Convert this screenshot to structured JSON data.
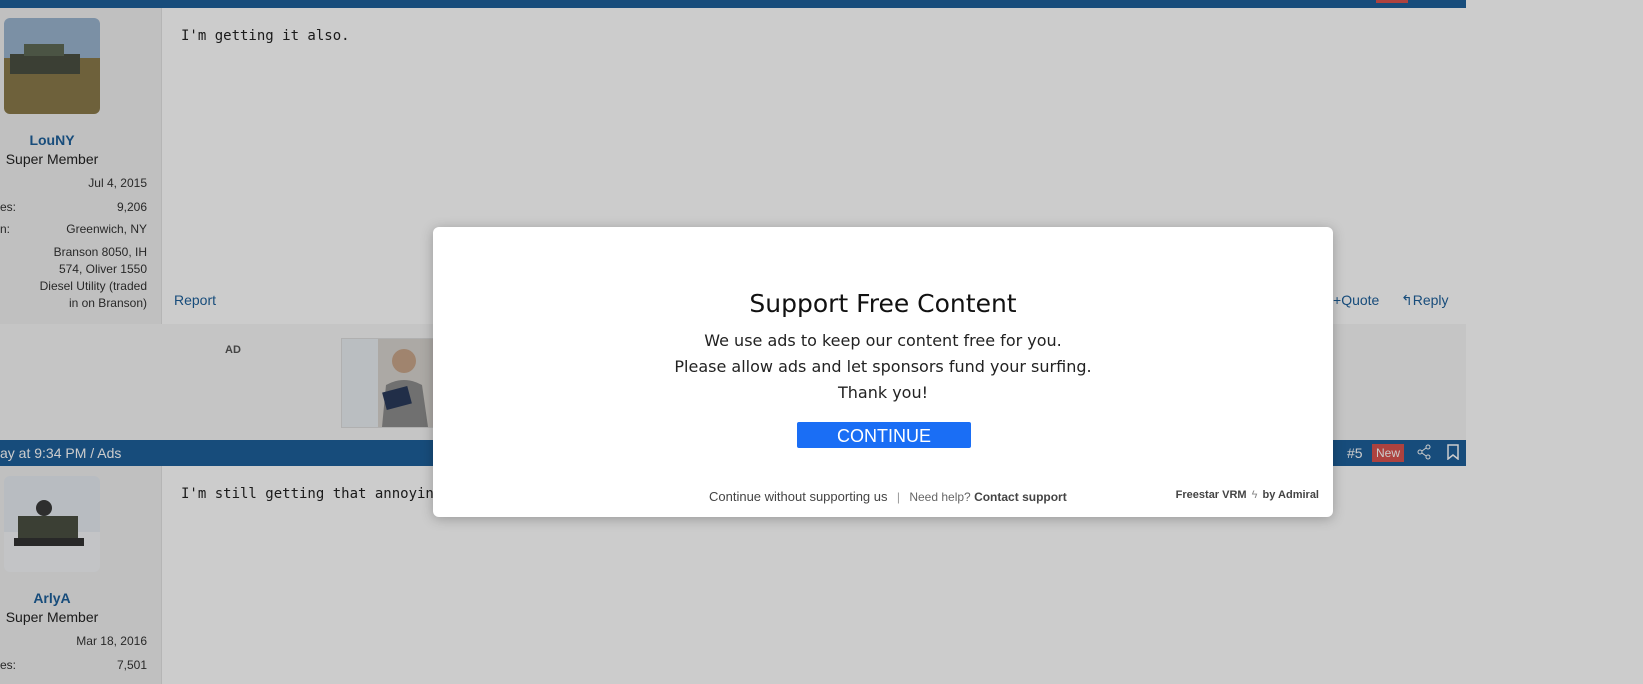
{
  "post1": {
    "username": "LouNY",
    "user_title": "Super Member",
    "joined": "Jul 4, 2015",
    "messages_key": "es:",
    "messages": "9,206",
    "location_key": "n:",
    "location": "Greenwich, NY",
    "equipment_lines": [
      "Branson 8050, IH",
      "574, Oliver 1550",
      "Diesel Utility (traded",
      "in on Branson)"
    ],
    "content": "I'm getting it also.",
    "report_label": "Report",
    "quote_label": "Quote",
    "reply_label": "Reply"
  },
  "ad": {
    "label": "AD"
  },
  "post2": {
    "header_left": "ay at 9:34 PM / Ads",
    "post_number": "#5",
    "new_badge": "New",
    "username": "ArlyA",
    "user_title": "Super Member",
    "joined": "Mar 18, 2016",
    "messages_key": "es:",
    "messages": "7,501",
    "content": "I'm still getting that annoying \"turn"
  },
  "modal": {
    "title": "Support Free Content",
    "line1": "We use ads to keep our content free for you.",
    "line2": "Please allow ads and let sponsors fund your surfing.",
    "line3": "Thank you!",
    "button": "CONTINUE",
    "continue_without": "Continue without supporting us",
    "separator": "|",
    "need_help": "Need help?",
    "contact_support": "Contact support",
    "brand": "Freestar VRM",
    "brand_by": "by Admiral"
  },
  "colors": {
    "accent": "#1d5f9a",
    "button": "#1a6ef5",
    "new_badge": "#d9534f"
  }
}
